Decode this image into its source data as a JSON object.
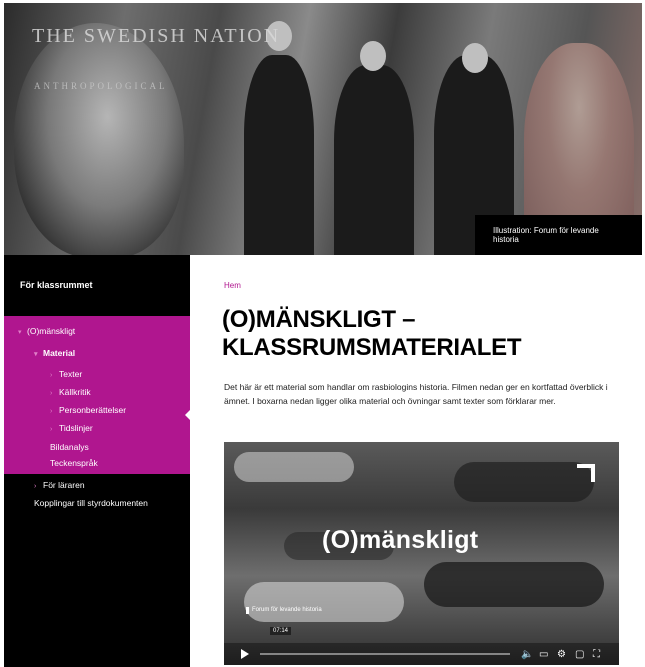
{
  "hero": {
    "title": "THE SWEDISH NATION",
    "subtitle": "ANTHROPOLOGICAL",
    "credit": "Illustration: Forum för levande historia"
  },
  "sidebar": {
    "header": "För klassrummet",
    "items": [
      {
        "label": "(O)mänskligt"
      },
      {
        "label": "Material"
      },
      {
        "label": "Texter"
      },
      {
        "label": "Källkritik"
      },
      {
        "label": "Personberättelser"
      },
      {
        "label": "Tidslinjer"
      },
      {
        "label": "Bildanalys"
      },
      {
        "label": "Teckenspråk"
      },
      {
        "label": "För läraren"
      },
      {
        "label": "Kopplingar till styrdokumenten"
      }
    ],
    "accent_color": "#b0168f"
  },
  "main": {
    "breadcrumb": "Hem",
    "title": "(O)MÄNSKLIGT – KLASSRUMSMATERIALET",
    "intro": "Det här är ett material som handlar om rasbiologins historia. Filmen nedan ger en kortfattad överblick i ämnet. I boxarna nedan ligger olika material och övningar samt texter som förklarar mer."
  },
  "video": {
    "title": "(O)mänskligt",
    "logo_text": "Forum för levande historia",
    "time": "07:14",
    "icons": [
      "play-icon",
      "volume-icon",
      "subtitles-icon",
      "settings-icon",
      "cast-icon",
      "fullscreen-icon"
    ]
  }
}
